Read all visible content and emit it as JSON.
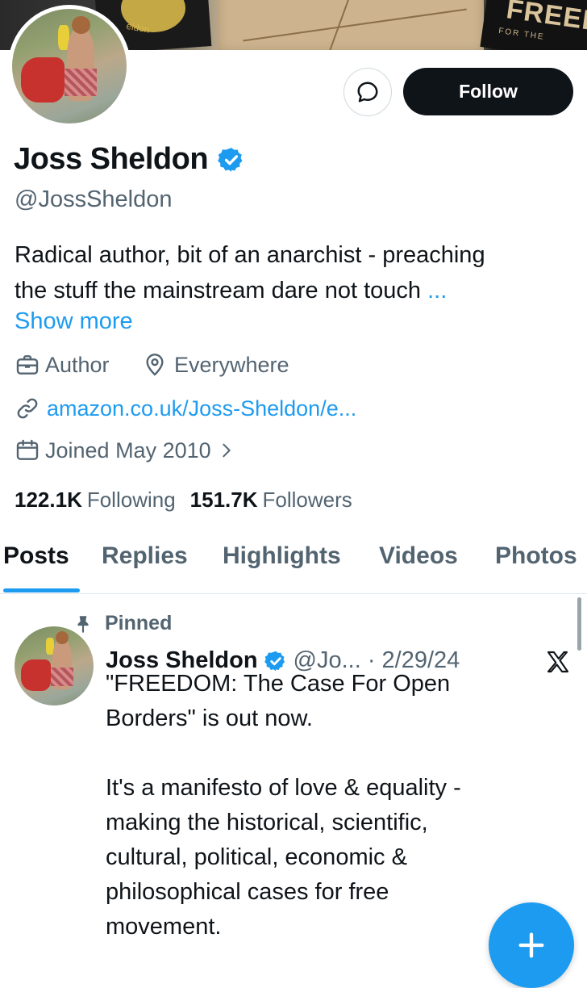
{
  "banner": {
    "book_left_text": "eldon",
    "book_right_title": "FREED",
    "book_right_subtitle": "FOR THE"
  },
  "profile": {
    "display_name": "Joss Sheldon",
    "handle": "@JossSheldon",
    "bio_line1": "Radical author, bit of an anarchist - preaching",
    "bio_line2": "the stuff the mainstream dare not touch",
    "bio_ellipsis": "...",
    "show_more": "Show more",
    "profession": "Author",
    "location": "Everywhere",
    "website": "amazon.co.uk/Joss-Sheldon/e...",
    "joined": "Joined May 2010",
    "following_count": "122.1K",
    "following_label": "Following",
    "followers_count": "151.7K",
    "followers_label": "Followers"
  },
  "actions": {
    "follow_label": "Follow",
    "message_icon": "message-bubble-icon"
  },
  "tabs": [
    {
      "label": "Posts",
      "active": true
    },
    {
      "label": "Replies",
      "active": false
    },
    {
      "label": "Highlights",
      "active": false
    },
    {
      "label": "Videos",
      "active": false
    },
    {
      "label": "Photos",
      "active": false
    }
  ],
  "pinned_tweet": {
    "pinned_label": "Pinned",
    "author": "Joss Sheldon",
    "handle_date": "@Jo... · 2/29/24",
    "text": "\"FREEDOM: The Case For Open\nBorders\" is out now.\n\nIt's a manifesto of love & equality -\nmaking the historical, scientific,\ncultural, political, economic &\nphilosophical cases for free\nmovement."
  },
  "colors": {
    "accent": "#1d9bf0",
    "text_primary": "#0f1419",
    "text_secondary": "#536471",
    "follow_bg": "#0f1419"
  }
}
